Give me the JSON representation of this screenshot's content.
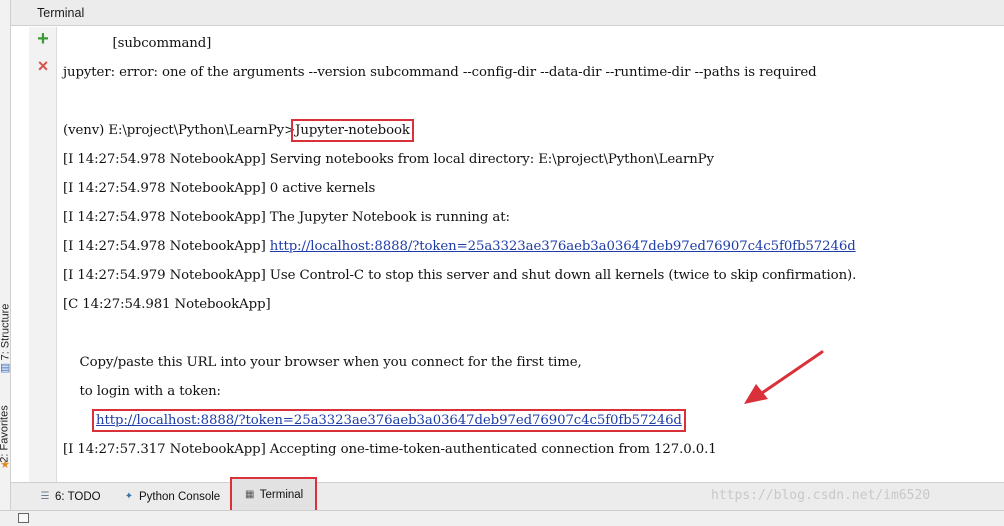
{
  "window": {
    "title": "Terminal"
  },
  "left_sidebar": {
    "structure_label": "7: Structure",
    "favorites_label": "2: Favorites"
  },
  "terminal": {
    "lines": [
      "            [subcommand]",
      "jupyter: error: one of the arguments --version subcommand --config-dir --data-dir --runtime-dir --paths is required",
      "",
      "(venv) E:\\project\\Python\\LearnPy>Jupyter-notebook",
      "[I 14:27:54.978 NotebookApp] Serving notebooks from local directory: E:\\project\\Python\\LearnPy",
      "[I 14:27:54.978 NotebookApp] 0 active kernels",
      "[I 14:27:54.978 NotebookApp] The Jupyter Notebook is running at:",
      "[I 14:27:54.978 NotebookApp] http://localhost:8888/?token=25a3323ae376aeb3a03647deb97ed76907c4c5f0fb57246d",
      "[I 14:27:54.979 NotebookApp] Use Control-C to stop this server and shut down all kernels (twice to skip confirmation).",
      "[C 14:27:54.981 NotebookApp]",
      "",
      "    Copy/paste this URL into your browser when you connect for the first time,",
      "    to login with a token:",
      "        http://localhost:8888/?token=25a3323ae376aeb3a03647deb97ed76907c4c5f0fb57246d",
      "[I 14:27:57.317 NotebookApp] Accepting one-time-token-authenticated connection from 127.0.0.1"
    ],
    "prompt": "(venv) E:\\project\\Python\\LearnPy>",
    "command": "Jupyter-notebook",
    "running_prefix": "[I 14:27:54.978 NotebookApp] ",
    "url": "http://localhost:8888/?token=25a3323ae376aeb3a03647deb97ed76907c4c5f0fb57246d",
    "login_indent": "        "
  },
  "bottom_tabs": {
    "todo": "6: TODO",
    "python_console": "Python Console",
    "terminal": "Terminal"
  },
  "watermark": "https://blog.csdn.net/im6520",
  "colors": {
    "highlight": "#d9303a",
    "link": "#1e3ca8",
    "add": "#3b9a35",
    "close": "#d9534f"
  }
}
